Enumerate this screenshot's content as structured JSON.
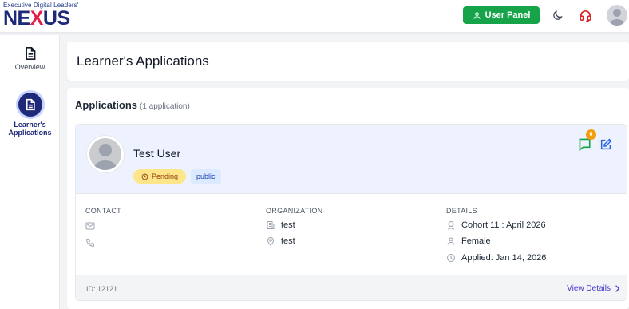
{
  "header": {
    "brand_tagline": "Executive Digital Leaders'",
    "brand_name_a": "NE",
    "brand_name_accent": "X",
    "brand_name_b": "US",
    "user_panel_label": "User Panel"
  },
  "icons": {
    "user_panel": "user-icon",
    "theme": "moon-icon",
    "support": "headset-icon",
    "account": "avatar"
  },
  "colors": {
    "brand": "#1e2a78",
    "accent": "#e11d48",
    "success": "#16a34a",
    "pending": "#fde68a",
    "link": "#4338ca"
  },
  "sidebar": {
    "items": [
      {
        "label": "Overview",
        "icon": "document-icon",
        "active": false
      },
      {
        "label_line1": "Learner's",
        "label_line2": "Applications",
        "icon": "document-icon",
        "active": true
      }
    ]
  },
  "page": {
    "title": "Learner's Applications"
  },
  "applications": {
    "heading": "Applications",
    "count_text": "(1 application)",
    "items": [
      {
        "name": "Test User",
        "status": "Pending",
        "visibility": "public",
        "message_count": "0",
        "contact_label": "CONTACT",
        "organization_label": "ORGANIZATION",
        "details_label": "DETAILS",
        "organization_name": "test",
        "organization_location": "test",
        "cohort": "Cohort 11 : April 2026",
        "gender": "Female",
        "applied": "Applied: Jan 14, 2026",
        "id_text": "ID: 12121",
        "view_details": "View Details"
      }
    ]
  }
}
